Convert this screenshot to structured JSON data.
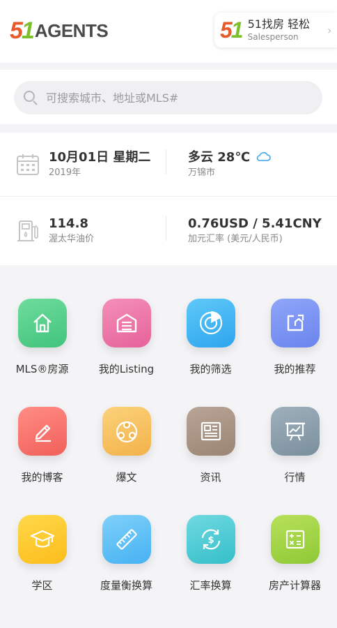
{
  "header": {
    "logo_five": "5",
    "logo_one": "1",
    "logo_text": "AGENTS",
    "account": {
      "logo_five": "5",
      "logo_one": "1",
      "name": "51找房 轻松",
      "role": "Salesperson",
      "chevron": "›"
    }
  },
  "search": {
    "placeholder": "可搜索城市、地址或MLS#",
    "value": ""
  },
  "info": {
    "date": {
      "main": "10月01日 星期二",
      "sub": "2019年",
      "icon": "calendar-icon"
    },
    "weather": {
      "main": "多云 28℃",
      "sub": "万锦市",
      "icon": "cloud-icon"
    },
    "gas": {
      "main": "114.8",
      "sub": "渥太华油价",
      "icon": "gas-pump-icon"
    },
    "fx": {
      "main": "0.76USD / 5.41CNY",
      "sub": "加元汇率 (美元/人民币)"
    }
  },
  "grid": {
    "items": [
      {
        "label": "MLS®房源",
        "icon": "house-icon",
        "color_a": "#6fdc9c",
        "color_b": "#41c47d"
      },
      {
        "label": "我的Listing",
        "icon": "garage-icon",
        "color_a": "#f48fb8",
        "color_b": "#e5629a"
      },
      {
        "label": "我的筛选",
        "icon": "radar-icon",
        "color_a": "#5fc9f8",
        "color_b": "#2da5ee"
      },
      {
        "label": "我的推荐",
        "icon": "share-icon",
        "color_a": "#8fa6f8",
        "color_b": "#6a84ee"
      },
      {
        "label": "我的博客",
        "icon": "pencil-icon",
        "color_a": "#ff8d85",
        "color_b": "#f1605a"
      },
      {
        "label": "爆文",
        "icon": "network-icon",
        "color_a": "#fcd27a",
        "color_b": "#f2b24a"
      },
      {
        "label": "资讯",
        "icon": "newspaper-icon",
        "color_a": "#b9a596",
        "color_b": "#9a8474"
      },
      {
        "label": "行情",
        "icon": "presentation-chart-icon",
        "color_a": "#9fb0bc",
        "color_b": "#7a8f9d"
      },
      {
        "label": "学区",
        "icon": "graduation-cap-icon",
        "color_a": "#ffd84a",
        "color_b": "#fbbd1b"
      },
      {
        "label": "度量衡换算",
        "icon": "ruler-icon",
        "color_a": "#7fd0fa",
        "color_b": "#46b2f2"
      },
      {
        "label": "汇率换算",
        "icon": "currency-exchange-icon",
        "color_a": "#6fd9e0",
        "color_b": "#35bfca"
      },
      {
        "label": "房产计算器",
        "icon": "calculator-icon",
        "color_a": "#b8e05a",
        "color_b": "#8ec936"
      }
    ]
  }
}
